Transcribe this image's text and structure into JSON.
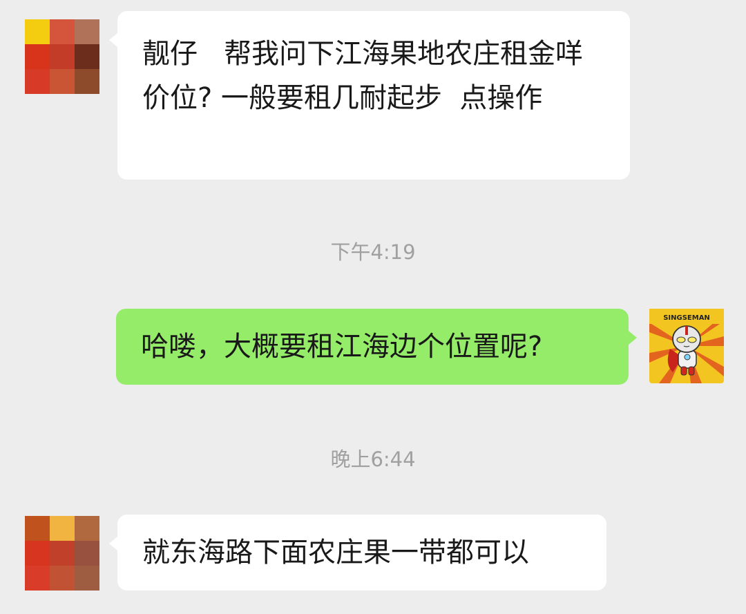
{
  "messages": [
    {
      "direction": "incoming",
      "text": "靓仔   帮我问下江海果地农庄租金咩价位? 一般要租几耐起步  点操作"
    },
    {
      "direction": "outgoing",
      "text": "哈喽，大概要租江海边个位置呢?"
    },
    {
      "direction": "incoming",
      "text": "就东海路下面农庄果一带都可以"
    }
  ],
  "timestamps": [
    "下午4:19",
    "晚上6:44"
  ],
  "self_avatar": {
    "caption": "SINGSEMAN",
    "icon": "cartoon-hero-icon",
    "colors": {
      "background": "#f2c521",
      "rays": "#e0541f"
    }
  },
  "contact_avatar_1": {
    "style": "pixelated-mosaic",
    "colors": [
      "#f5cd10",
      "#d4553c",
      "#b0735a",
      "#d8341c",
      "#c23c27",
      "#6d2d1c",
      "#d73b27",
      "#c95535",
      "#8e4b2c"
    ]
  },
  "contact_avatar_2": {
    "style": "pixelated-mosaic",
    "colors": [
      "#c0521d",
      "#f2b440",
      "#b0693f",
      "#d83521",
      "#c04029",
      "#98513e",
      "#d93d29",
      "#c25234",
      "#9e5c40"
    ]
  },
  "colors": {
    "chat_background": "#ededed",
    "incoming_bubble": "#ffffff",
    "outgoing_bubble": "#95ec69",
    "timestamp_text": "#a0a0a0"
  }
}
